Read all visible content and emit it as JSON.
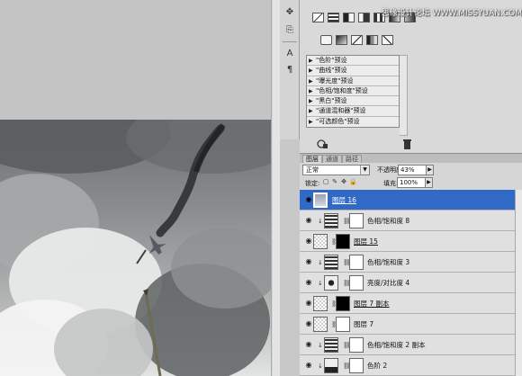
{
  "watermark": "思缘设计论坛 WWW.MISSYUAN.COM",
  "colors": {
    "selected_row": "#3169c6",
    "panel_bg": "#d6d6d6",
    "row_bg": "#e0e0e0"
  },
  "adjustments": {
    "tool_icons": [
      "curves-icon",
      "levels-icon",
      "vibrance-icon",
      "hue-icon",
      "brightness-icon",
      "gradient-map-icon",
      "threshold-icon",
      "photo-filter-icon",
      "channel-mixer-icon",
      "invert-icon",
      "posterize-icon",
      "selective-color-icon"
    ],
    "presets": [
      "\"色阶\"预设",
      "\"曲线\"预设",
      "\"曝光度\"预设",
      "\"色相/饱和度\"预设",
      "\"黑白\"预设",
      "\"通道混和器\"预设",
      "\"可选颜色\"预设"
    ]
  },
  "layers_panel": {
    "tabs": [
      "图层",
      "通道",
      "路径"
    ],
    "blend_mode": "正常",
    "opacity_label": "不透明度:",
    "opacity_value": "43%",
    "lock_label": "锁定:",
    "fill_label": "填充:",
    "fill_value": "100%",
    "layers": [
      {
        "name": "图层 16",
        "selected": true
      },
      {
        "name": "色相/饱和度 8",
        "selected": false
      },
      {
        "name": "图层 15",
        "selected": false
      },
      {
        "name": "色相/饱和度 3",
        "selected": false
      },
      {
        "name": "亮度/对比度 4",
        "selected": false
      },
      {
        "name": "图层 7 副本",
        "selected": false
      },
      {
        "name": "图层 7",
        "selected": false
      },
      {
        "name": "色相/饱和度 2 副本",
        "selected": false
      },
      {
        "name": "色阶 2",
        "selected": false
      }
    ]
  }
}
